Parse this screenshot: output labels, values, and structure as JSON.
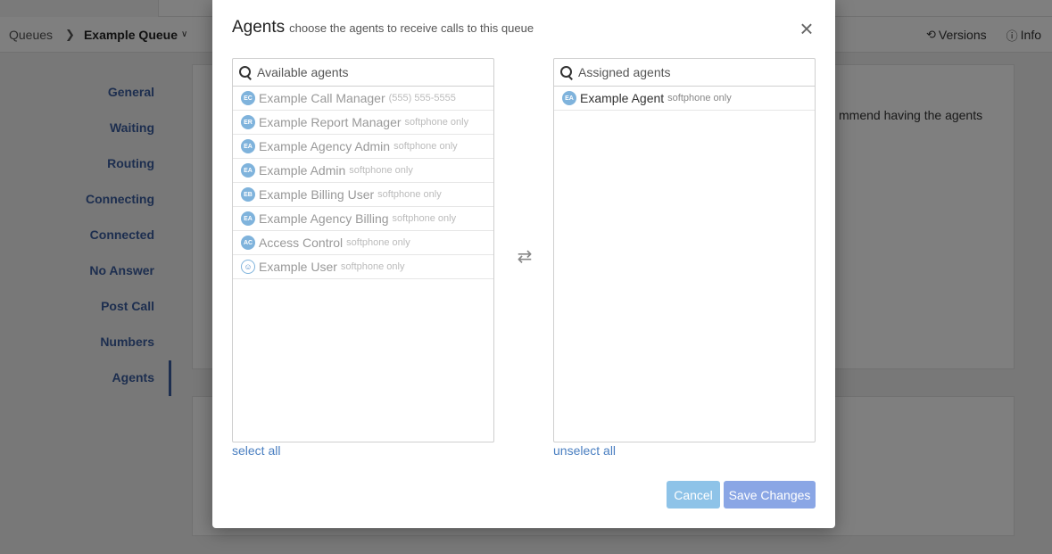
{
  "breadcrumb": {
    "queues": "Queues",
    "current": "Example Queue"
  },
  "header_actions": {
    "versions": "Versions",
    "info": "Info"
  },
  "sidebar": {
    "items": [
      "General",
      "Waiting",
      "Routing",
      "Connecting",
      "Connected",
      "No Answer",
      "Post Call",
      "Numbers",
      "Agents"
    ],
    "active": "Agents"
  },
  "background_text": "mmend having the agents",
  "modal": {
    "title": "Agents",
    "subtitle": "choose the agents to receive calls to this queue",
    "close": "×",
    "available": {
      "placeholder": "Available agents",
      "items": [
        {
          "initials": "EC",
          "name": "Example Call Manager",
          "meta": "(555) 555-5555"
        },
        {
          "initials": "ER",
          "name": "Example Report Manager",
          "meta": "softphone only"
        },
        {
          "initials": "EA",
          "name": "Example Agency Admin",
          "meta": "softphone only"
        },
        {
          "initials": "EA",
          "name": "Example Admin",
          "meta": "softphone only"
        },
        {
          "initials": "EB",
          "name": "Example Billing User",
          "meta": "softphone only"
        },
        {
          "initials": "EA",
          "name": "Example Agency Billing",
          "meta": "softphone only"
        },
        {
          "initials": "AC",
          "name": "Access Control",
          "meta": "softphone only"
        },
        {
          "initials": "",
          "name": "Example User",
          "meta": "softphone only"
        }
      ],
      "select_all": "select all"
    },
    "assigned": {
      "placeholder": "Assigned agents",
      "items": [
        {
          "initials": "EA",
          "name": "Example Agent",
          "meta": "softphone only"
        }
      ],
      "unselect_all": "unselect all"
    },
    "cancel_label": "Cancel",
    "save_label": "Save Changes"
  },
  "colors": {
    "link": "#4a7fc1",
    "nav": "#3a5d9f",
    "avatar": "#7fb3dc",
    "cancel": "#8ec3e8",
    "save": "#8aa6e5"
  }
}
